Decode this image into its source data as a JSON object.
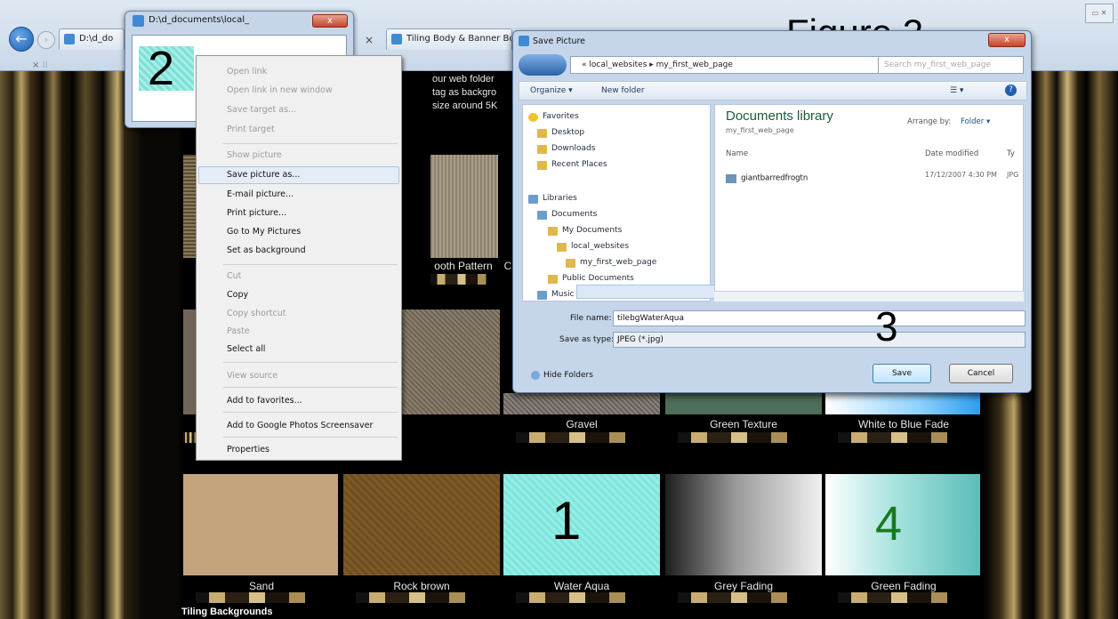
{
  "browser": {
    "tabs": [
      {
        "label": "D:\\d_do"
      },
      {
        "label": "Tiling Body & Banner Bo"
      }
    ],
    "tab_close": "×",
    "back_glyph": "←",
    "cmd_close": "×",
    "cmd_label": "⁞⁞"
  },
  "annotation": {
    "figure": "Figure 2",
    "n1": "1",
    "n2": "2",
    "n3": "3",
    "n4": "4"
  },
  "small_window": {
    "title": "D:\\d_documents\\local_",
    "close": "x"
  },
  "page": {
    "intro_lines": [
      "our web folder",
      "tag as backgro",
      "size around 5K"
    ],
    "row1_labels": [
      "",
      "ooth Pattern",
      "C"
    ],
    "row2_labels": [
      "",
      "Gravel",
      "Green Texture",
      "White to Blue Fade"
    ],
    "row3_labels": [
      "Sand",
      "Rock brown",
      "Water Aqua",
      "Grey Fading",
      "Green Fading"
    ],
    "footer": "Tiling Backgrounds"
  },
  "context_menu": {
    "items": [
      {
        "label": "Open link",
        "enabled": false
      },
      {
        "label": "Open link in new window",
        "enabled": false
      },
      {
        "label": "Save target as...",
        "enabled": false
      },
      {
        "label": "Print target",
        "enabled": false
      },
      {
        "label": "Show picture",
        "enabled": false
      },
      {
        "label": "Save picture as...",
        "enabled": true,
        "highlight": true
      },
      {
        "label": "E-mail picture...",
        "enabled": true
      },
      {
        "label": "Print picture...",
        "enabled": true
      },
      {
        "label": "Go to My Pictures",
        "enabled": true
      },
      {
        "label": "Set as background",
        "enabled": true
      },
      {
        "label": "Cut",
        "enabled": false
      },
      {
        "label": "Copy",
        "enabled": true
      },
      {
        "label": "Copy shortcut",
        "enabled": false
      },
      {
        "label": "Paste",
        "enabled": false
      },
      {
        "label": "Select all",
        "enabled": true
      },
      {
        "label": "View source",
        "enabled": false
      },
      {
        "label": "Add to favorites...",
        "enabled": true
      },
      {
        "label": "Add to Google Photos Screensaver",
        "enabled": true
      },
      {
        "label": "Properties",
        "enabled": true
      }
    ]
  },
  "save_dialog": {
    "title": "Save Picture",
    "close": "x",
    "address": "« local_websites ▸ my_first_web_page",
    "search_placeholder": "Search my_first_web_page",
    "organize": "Organize ▾",
    "new_folder": "New folder",
    "nav": [
      {
        "label": "Favorites",
        "type": "star",
        "indent": 0
      },
      {
        "label": "Desktop",
        "type": "folder",
        "indent": 1
      },
      {
        "label": "Downloads",
        "type": "folder",
        "indent": 1
      },
      {
        "label": "Recent Places",
        "type": "folder",
        "indent": 1
      },
      {
        "label": "Libraries",
        "type": "lib",
        "indent": 0
      },
      {
        "label": "Documents",
        "type": "lib",
        "indent": 1
      },
      {
        "label": "My Documents",
        "type": "folder",
        "indent": 2
      },
      {
        "label": "local_websites",
        "type": "folder",
        "indent": 3
      },
      {
        "label": "my_first_web_page",
        "type": "folder",
        "indent": 4
      },
      {
        "label": "Public Documents",
        "type": "folder",
        "indent": 2
      },
      {
        "label": "Music",
        "type": "lib",
        "indent": 1
      }
    ],
    "library_title": "Documents library",
    "library_sub": "my_first_web_page",
    "arrange_label": "Arrange by:",
    "arrange_value": "Folder ▾",
    "col_name": "Name",
    "col_date": "Date modified",
    "col_type": "Ty",
    "files": [
      {
        "name": "giantbarredfrogtn",
        "date": "17/12/2007 4:30 PM",
        "type": "JPG"
      }
    ],
    "file_name_label": "File name:",
    "file_name_value": "tilebgWaterAqua",
    "save_type_label": "Save as type:",
    "save_type_value": "JPEG (*.jpg)",
    "hide_folders": "Hide Folders",
    "save_btn": "Save",
    "cancel_btn": "Cancel"
  },
  "colors": {
    "sand": "#c3a47d",
    "rock": "#6f4f21",
    "aqua": "#7ee5dc",
    "grey_from": "#1e1e1e",
    "grey_to": "#f0f0f0",
    "green_fade_from": "#ffffff",
    "green_fade_to": "#7fd0cc",
    "number4": "#177a1c"
  }
}
